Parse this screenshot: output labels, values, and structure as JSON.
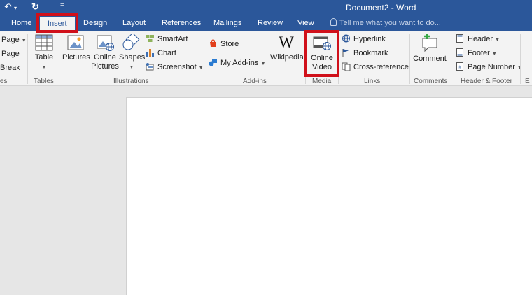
{
  "window": {
    "title": "Document2 - Word"
  },
  "quick_access": {
    "undo_glyph": "↶",
    "redo_glyph": "↻",
    "customize_glyph": "="
  },
  "tabs": [
    {
      "label": "Home"
    },
    {
      "label": "Insert",
      "active": true
    },
    {
      "label": "Design"
    },
    {
      "label": "Layout"
    },
    {
      "label": "References"
    },
    {
      "label": "Mailings"
    },
    {
      "label": "Review"
    },
    {
      "label": "View"
    }
  ],
  "tell_me": {
    "placeholder": "Tell me what you want to do..."
  },
  "ribbon": {
    "pages": {
      "cover_page": "Page",
      "blank_page": "Page",
      "page_break": "Break",
      "label": "es"
    },
    "tables": {
      "table": "Table",
      "label": "Tables"
    },
    "illustrations": {
      "pictures": "Pictures",
      "online_pictures_1": "Online",
      "online_pictures_2": "Pictures",
      "shapes": "Shapes",
      "smartart": "SmartArt",
      "chart": "Chart",
      "screenshot": "Screenshot",
      "label": "Illustrations"
    },
    "addins": {
      "store": "Store",
      "my_addins": "My Add-ins",
      "wikipedia": "Wikipedia",
      "wikipedia_glyph": "W",
      "label": "Add-ins"
    },
    "media": {
      "online_video_1": "Online",
      "online_video_2": "Video",
      "label": "Media"
    },
    "links": {
      "hyperlink": "Hyperlink",
      "bookmark": "Bookmark",
      "cross_reference": "Cross-reference",
      "label": "Links"
    },
    "comments": {
      "comment": "Comment",
      "label": "Comments"
    },
    "header_footer": {
      "header": "Header",
      "footer": "Footer",
      "page_number": "Page Number",
      "label": "Header & Footer"
    },
    "text_partial": {
      "label": "E"
    }
  },
  "colors": {
    "brand": "#2b579a",
    "highlight": "#d0101a"
  }
}
